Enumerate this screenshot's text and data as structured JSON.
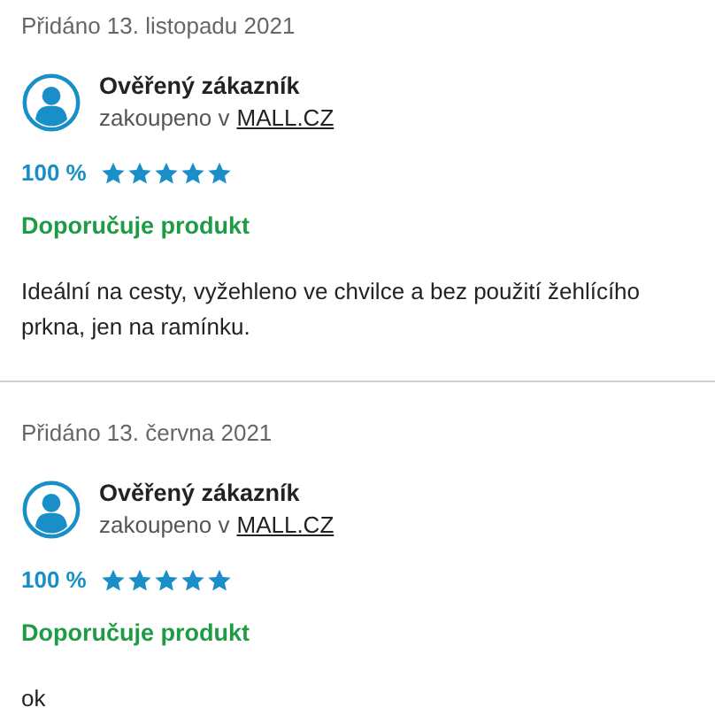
{
  "reviews": [
    {
      "date": "Přidáno 13. listopadu 2021",
      "author": "Ověřený zákazník",
      "purchased": "zakoupeno v",
      "store": "MALL.CZ",
      "percent": "100 %",
      "stars": 5,
      "recommendation": "Doporučuje produkt",
      "text": "Ideální na cesty, vyžehleno ve chvilce a bez použití žehlícího prkna, jen na ramínku."
    },
    {
      "date": "Přidáno 13. června 2021",
      "author": "Ověřený zákazník",
      "purchased": "zakoupeno v",
      "store": "MALL.CZ",
      "percent": "100 %",
      "stars": 5,
      "recommendation": "Doporučuje produkt",
      "text": "ok"
    }
  ]
}
